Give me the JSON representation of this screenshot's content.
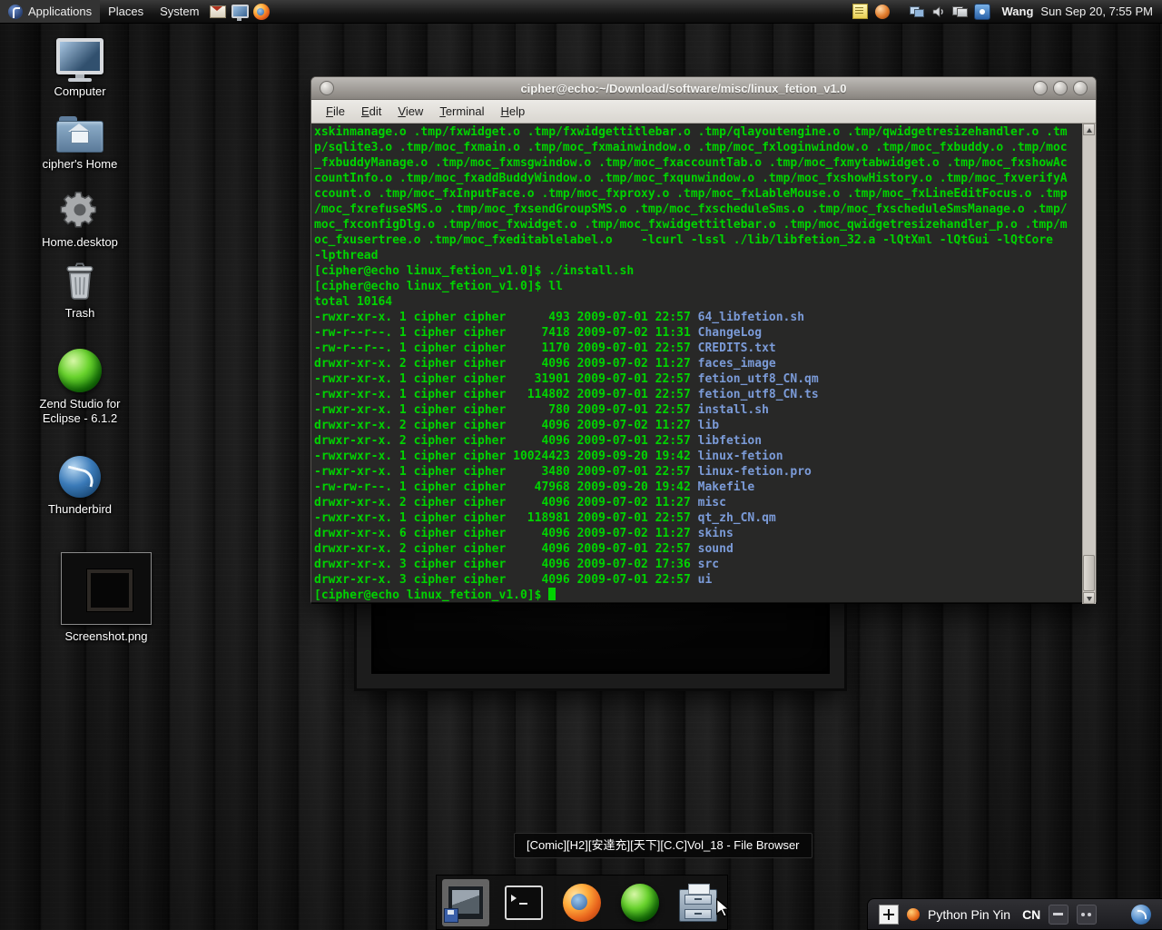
{
  "panel": {
    "menus": [
      {
        "label": "Applications"
      },
      {
        "label": "Places"
      },
      {
        "label": "System"
      }
    ],
    "launchers": [
      "mail-icon",
      "display-icon",
      "firefox-icon"
    ],
    "tray": [
      "notes-icon",
      "globe-icon",
      "network-icon",
      "volume-icon",
      "displays-icon",
      "input-method-icon"
    ],
    "username": "Wang",
    "clock": "Sun Sep 20, 7:55 PM"
  },
  "desktop": {
    "icons": [
      {
        "name": "computer",
        "label": "Computer"
      },
      {
        "name": "cipher-home",
        "label": "cipher's Home"
      },
      {
        "name": "home-desktop",
        "label": "Home.desktop"
      },
      {
        "name": "trash",
        "label": "Trash"
      },
      {
        "name": "zend-studio",
        "label": "Zend Studio for\nEclipse - 6.1.2"
      },
      {
        "name": "thunderbird",
        "label": "Thunderbird"
      },
      {
        "name": "screenshot",
        "label": "Screenshot.png"
      }
    ]
  },
  "window": {
    "title": "cipher@echo:~/Download/software/misc/linux_fetion_v1.0",
    "menu": [
      {
        "label": "File"
      },
      {
        "label": "Edit"
      },
      {
        "label": "View"
      },
      {
        "label": "Terminal"
      },
      {
        "label": "Help"
      }
    ]
  },
  "terminal": {
    "colors": {
      "green": "#00d300",
      "blue": "#7b9bd8",
      "background": "rgba(0,0,0,0.82)"
    },
    "lines": [
      [
        [
          "xskinmanage.o .tmp/fxwidget.o .tmp/fxwidgettitlebar.o .tmp/qlayoutengine.o .tmp/qwidgetresizehandler.o .tm",
          "g"
        ]
      ],
      [
        [
          "p/sqlite3.o .tmp/moc_fxmain.o .tmp/moc_fxmainwindow.o .tmp/moc_fxloginwindow.o .tmp/moc_fxbuddy.o .tmp/moc",
          "g"
        ]
      ],
      [
        [
          "_fxbuddyManage.o .tmp/moc_fxmsgwindow.o .tmp/moc_fxaccountTab.o .tmp/moc_fxmytabwidget.o .tmp/moc_fxshowAc",
          "g"
        ]
      ],
      [
        [
          "countInfo.o .tmp/moc_fxaddBuddyWindow.o .tmp/moc_fxqunwindow.o .tmp/moc_fxshowHistory.o .tmp/moc_fxverifyA",
          "g"
        ]
      ],
      [
        [
          "ccount.o .tmp/moc_fxInputFace.o .tmp/moc_fxproxy.o .tmp/moc_fxLableMouse.o .tmp/moc_fxLineEditFocus.o .tmp",
          "g"
        ]
      ],
      [
        [
          "/moc_fxrefuseSMS.o .tmp/moc_fxsendGroupSMS.o .tmp/moc_fxscheduleSms.o .tmp/moc_fxscheduleSmsManage.o .tmp/",
          "g"
        ]
      ],
      [
        [
          "moc_fxconfigDlg.o .tmp/moc_fxwidget.o .tmp/moc_fxwidgettitlebar.o .tmp/moc_qwidgetresizehandler_p.o .tmp/m",
          "g"
        ]
      ],
      [
        [
          "oc_fxusertree.o .tmp/moc_fxeditablelabel.o    -lcurl -lssl ./lib/libfetion_32.a -lQtXml -lQtGui -lQtCore",
          "g"
        ]
      ],
      [
        [
          "-lpthread",
          "g"
        ]
      ],
      [
        [
          "[cipher@echo linux_fetion_v1.0]$ ./install.sh",
          "g"
        ]
      ],
      [
        [
          "[cipher@echo linux_fetion_v1.0]$ ll",
          "g"
        ]
      ],
      [
        [
          "total 10164",
          "g"
        ]
      ],
      [
        [
          "-rwxr-xr-x. 1 cipher cipher      493 2009-07-01 22:57 ",
          "g"
        ],
        [
          "64_libfetion.sh",
          "b"
        ]
      ],
      [
        [
          "-rw-r--r--. 1 cipher cipher     7418 2009-07-02 11:31 ",
          "g"
        ],
        [
          "ChangeLog",
          "b"
        ]
      ],
      [
        [
          "-rw-r--r--. 1 cipher cipher     1170 2009-07-01 22:57 ",
          "g"
        ],
        [
          "CREDITS.txt",
          "b"
        ]
      ],
      [
        [
          "drwxr-xr-x. 2 cipher cipher     4096 2009-07-02 11:27 ",
          "g"
        ],
        [
          "faces_image",
          "b"
        ]
      ],
      [
        [
          "-rwxr-xr-x. 1 cipher cipher    31901 2009-07-01 22:57 ",
          "g"
        ],
        [
          "fetion_utf8_CN.qm",
          "b"
        ]
      ],
      [
        [
          "-rwxr-xr-x. 1 cipher cipher   114802 2009-07-01 22:57 ",
          "g"
        ],
        [
          "fetion_utf8_CN.ts",
          "b"
        ]
      ],
      [
        [
          "-rwxr-xr-x. 1 cipher cipher      780 2009-07-01 22:57 ",
          "g"
        ],
        [
          "install.sh",
          "b"
        ]
      ],
      [
        [
          "drwxr-xr-x. 2 cipher cipher     4096 2009-07-02 11:27 ",
          "g"
        ],
        [
          "lib",
          "b"
        ]
      ],
      [
        [
          "drwxr-xr-x. 2 cipher cipher     4096 2009-07-01 22:57 ",
          "g"
        ],
        [
          "libfetion",
          "b"
        ]
      ],
      [
        [
          "-rwxrwxr-x. 1 cipher cipher 10024423 2009-09-20 19:42 ",
          "g"
        ],
        [
          "linux-fetion",
          "b"
        ]
      ],
      [
        [
          "-rwxr-xr-x. 1 cipher cipher     3480 2009-07-01 22:57 ",
          "g"
        ],
        [
          "linux-fetion.pro",
          "b"
        ]
      ],
      [
        [
          "-rw-rw-r--. 1 cipher cipher    47968 2009-09-20 19:42 ",
          "g"
        ],
        [
          "Makefile",
          "b"
        ]
      ],
      [
        [
          "drwxr-xr-x. 2 cipher cipher     4096 2009-07-02 11:27 ",
          "g"
        ],
        [
          "misc",
          "b"
        ]
      ],
      [
        [
          "-rwxr-xr-x. 1 cipher cipher   118981 2009-07-01 22:57 ",
          "g"
        ],
        [
          "qt_zh_CN.qm",
          "b"
        ]
      ],
      [
        [
          "drwxr-xr-x. 6 cipher cipher     4096 2009-07-02 11:27 ",
          "g"
        ],
        [
          "skins",
          "b"
        ]
      ],
      [
        [
          "drwxr-xr-x. 2 cipher cipher     4096 2009-07-01 22:57 ",
          "g"
        ],
        [
          "sound",
          "b"
        ]
      ],
      [
        [
          "drwxr-xr-x. 3 cipher cipher     4096 2009-07-02 17:36 ",
          "g"
        ],
        [
          "src",
          "b"
        ]
      ],
      [
        [
          "drwxr-xr-x. 3 cipher cipher     4096 2009-07-01 22:57 ",
          "g"
        ],
        [
          "ui",
          "b"
        ]
      ],
      [
        [
          "[cipher@echo linux_fetion_v1.0]$ ",
          "g"
        ],
        [
          "",
          "cursor"
        ]
      ]
    ]
  },
  "tooltip": {
    "text": "[Comic][H2][安達充][天下][C.C]Vol_18 - File Browser"
  },
  "dock": {
    "items": [
      "image-viewer-icon",
      "terminal-icon",
      "firefox-icon",
      "zend-icon",
      "file-browser-icon"
    ]
  },
  "im_bar": {
    "engine": "Python Pin Yin",
    "lang": "CN"
  }
}
